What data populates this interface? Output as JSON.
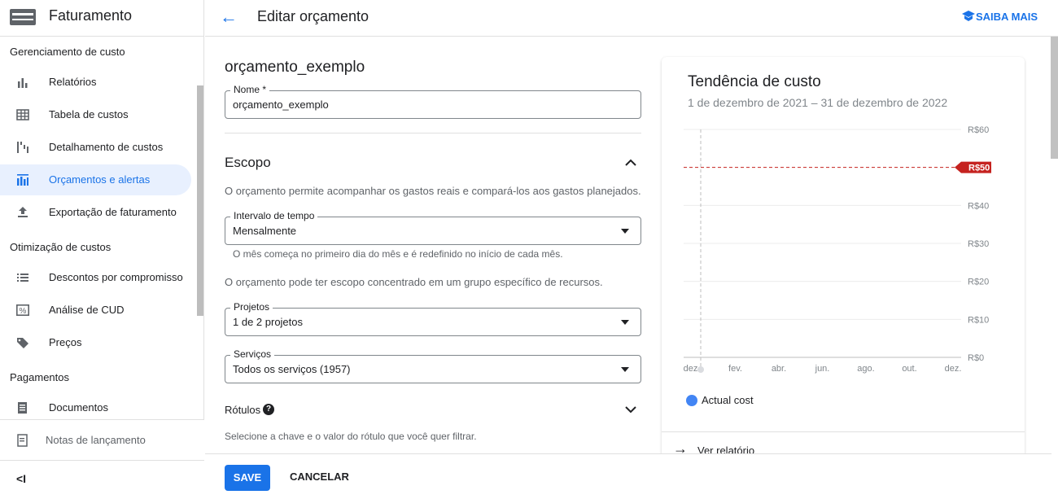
{
  "app": {
    "title": "Faturamento"
  },
  "sidebar": {
    "sections": [
      "Gerenciamento de custo",
      "Otimização de custos",
      "Pagamentos"
    ],
    "items": [
      {
        "label": "Relatórios",
        "icon": "bar-chart-icon"
      },
      {
        "label": "Tabela de custos",
        "icon": "table-icon"
      },
      {
        "label": "Detalhamento de custos",
        "icon": "breakdown-icon"
      },
      {
        "label": "Orçamentos e alertas",
        "icon": "budget-icon",
        "active": true
      },
      {
        "label": "Exportação de faturamento",
        "icon": "upload-icon"
      },
      {
        "label": "Descontos por compromisso",
        "icon": "list-icon"
      },
      {
        "label": "Análise de CUD",
        "icon": "percent-icon"
      },
      {
        "label": "Preços",
        "icon": "tag-icon"
      },
      {
        "label": "Documentos",
        "icon": "document-icon"
      }
    ],
    "release_notes": "Notas de lançamento",
    "collapse_icon": "collapse-icon"
  },
  "header": {
    "title": "Editar orçamento",
    "learn_more": "SAIBA MAIS"
  },
  "form": {
    "budget_title": "orçamento_exemplo",
    "name_label": "Nome *",
    "name_value": "orçamento_exemplo",
    "scope_title": "Escopo",
    "scope_desc": "O orçamento permite acompanhar os gastos reais e compará-los aos gastos planejados.",
    "interval_label": "Intervalo de tempo",
    "interval_value": "Mensalmente",
    "interval_help": "O mês começa no primeiro dia do mês e é redefinido no início de cada mês.",
    "scope_help": "O orçamento pode ter escopo concentrado em um grupo específico de recursos.",
    "projects_label": "Projetos",
    "projects_value": "1 de 2 projetos",
    "services_label": "Serviços",
    "services_value": "Todos os serviços (1957)",
    "labels_title": "Rótulos",
    "labels_help": "Selecione a chave e o valor do rótulo que você quer filtrar."
  },
  "actions": {
    "save": "SAVE",
    "cancel": "CANCELAR"
  },
  "chart": {
    "title": "Tendência de custo",
    "range": "1 de dezembro de 2021 – 31 de dezembro de 2022",
    "view_report": "Ver relatório",
    "budget_label": "R$50"
  },
  "chart_data": {
    "type": "line",
    "title": "Tendência de custo",
    "x": [
      "dez.",
      "fev.",
      "abr.",
      "jun.",
      "ago.",
      "out.",
      "dez."
    ],
    "yticks": [
      "R$0",
      "R$10",
      "R$20",
      "R$30",
      "R$40",
      "R$50",
      "R$60"
    ],
    "ylim": [
      0,
      60
    ],
    "budget_line": 50,
    "series": [
      {
        "name": "Actual cost",
        "color": "#4285f4",
        "values": [
          0
        ]
      }
    ],
    "legend": "bottom-left",
    "grid": true
  }
}
